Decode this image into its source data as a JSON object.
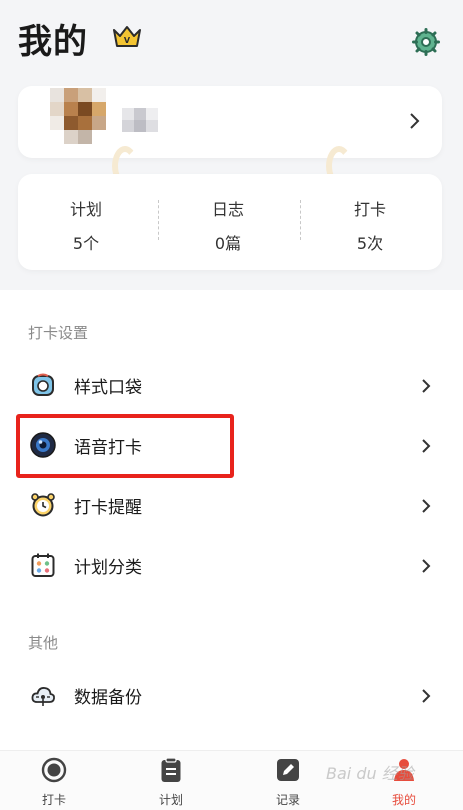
{
  "header": {
    "title": "我的",
    "crown_icon": "crown-icon",
    "crown_letter": "V",
    "settings_icon": "gear-icon"
  },
  "profile": {
    "avatar": "blurred-avatar",
    "chevron_icon": "chevron-right-icon"
  },
  "stats": [
    {
      "label": "计划",
      "value": "5个"
    },
    {
      "label": "日志",
      "value": "0篇"
    },
    {
      "label": "打卡",
      "value": "5次"
    }
  ],
  "sections": {
    "checkin_settings": {
      "title": "打卡设置",
      "items": [
        {
          "label": "样式口袋",
          "icon": "pocket-icon"
        },
        {
          "label": "语音打卡",
          "icon": "voice-lens-icon"
        },
        {
          "label": "打卡提醒",
          "icon": "alarm-clock-icon"
        },
        {
          "label": "计划分类",
          "icon": "category-calendar-icon"
        }
      ]
    },
    "other": {
      "title": "其他",
      "items": [
        {
          "label": "数据备份",
          "icon": "cloud-backup-icon"
        }
      ]
    }
  },
  "tabbar": {
    "tabs": [
      {
        "label": "打卡",
        "icon": "checkin-circle-icon",
        "active": false
      },
      {
        "label": "计划",
        "icon": "clipboard-icon",
        "active": false
      },
      {
        "label": "记录",
        "icon": "edit-icon",
        "active": false
      },
      {
        "label": "我的",
        "icon": "person-icon",
        "active": true
      }
    ]
  },
  "watermark": "Bai du 经验",
  "colors": {
    "accent_red": "#e74c3c",
    "highlight_border": "#e8231c",
    "gear_green": "#3c8d6e",
    "crown_gold": "#f3c432"
  }
}
